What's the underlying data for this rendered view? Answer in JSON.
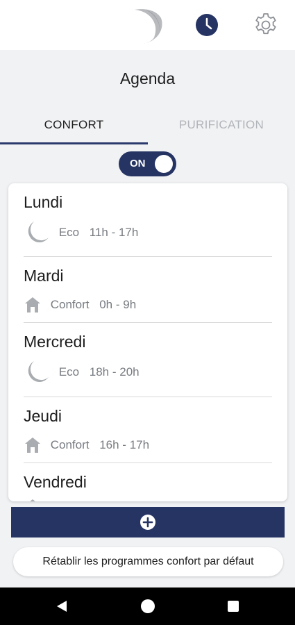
{
  "header": {
    "logo_icon": "crescent-logo-icon",
    "schedule_icon": "clock-icon",
    "settings_icon": "gear-icon"
  },
  "page": {
    "title": "Agenda"
  },
  "tabs": [
    {
      "label": "CONFORT",
      "active": true
    },
    {
      "label": "PURIFICATION",
      "active": false
    }
  ],
  "toggle": {
    "label": "ON",
    "state": true
  },
  "days": [
    {
      "name": "Lundi",
      "mode": "Eco",
      "icon": "moon-icon",
      "hours": "11h - 17h"
    },
    {
      "name": "Mardi",
      "mode": "Confort",
      "icon": "house-icon",
      "hours": "0h - 9h"
    },
    {
      "name": "Mercredi",
      "mode": "Eco",
      "icon": "moon-icon",
      "hours": "18h - 20h"
    },
    {
      "name": "Jeudi",
      "mode": "Confort",
      "icon": "house-icon",
      "hours": "16h - 17h"
    },
    {
      "name": "Vendredi",
      "mode": "",
      "icon": "house-icon",
      "hours": ""
    }
  ],
  "add_button": {
    "icon": "plus-circle-icon"
  },
  "reset_button": {
    "label": "Rétablir les programmes confort par défaut"
  },
  "colors": {
    "primary": "#263463",
    "background": "#f1f2f4",
    "inactive_tab": "#b1b4b9",
    "icon_gray": "#a9acb0"
  }
}
